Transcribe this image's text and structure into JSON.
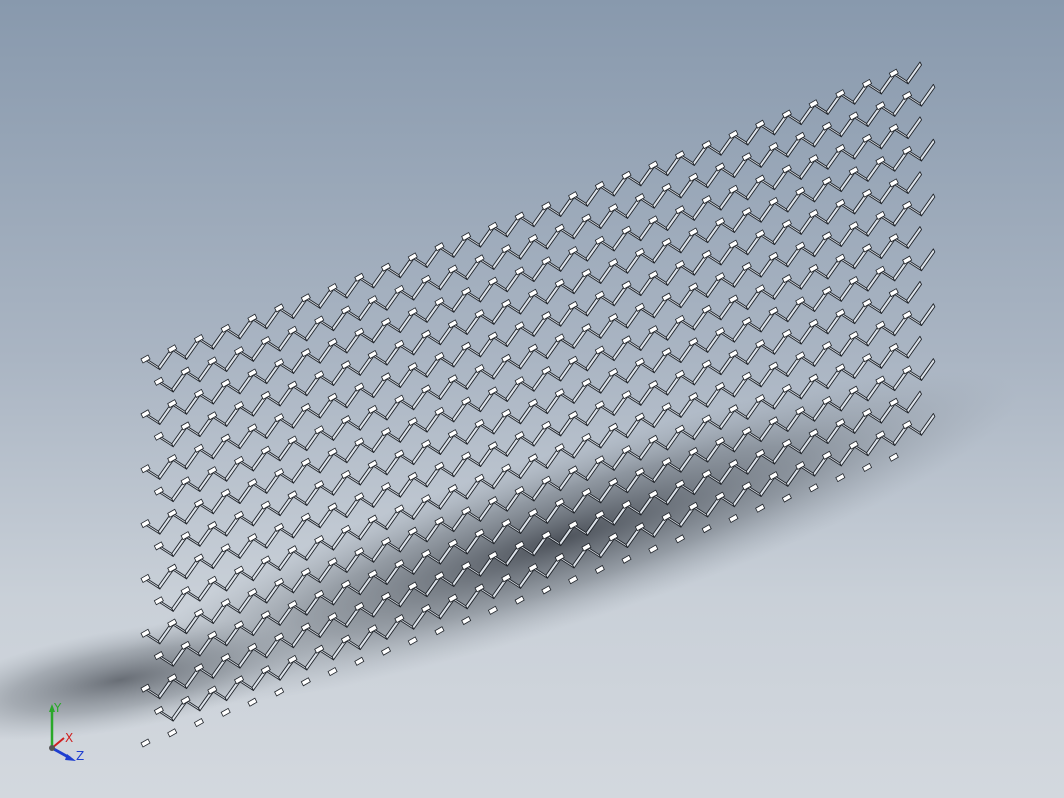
{
  "viewport": {
    "background_top": "#8899ad",
    "background_bottom": "#d3d8de"
  },
  "model": {
    "name": "expanded-metal-mesh",
    "rows": 14,
    "columns": 29,
    "strand_color": "#dde3ea",
    "edge_color": "#20242a"
  },
  "triad": {
    "x_label": "X",
    "y_label": "Y",
    "z_label": "Z",
    "x_color": "#d02020",
    "y_color": "#2aa82a",
    "z_color": "#1f3fd0"
  }
}
